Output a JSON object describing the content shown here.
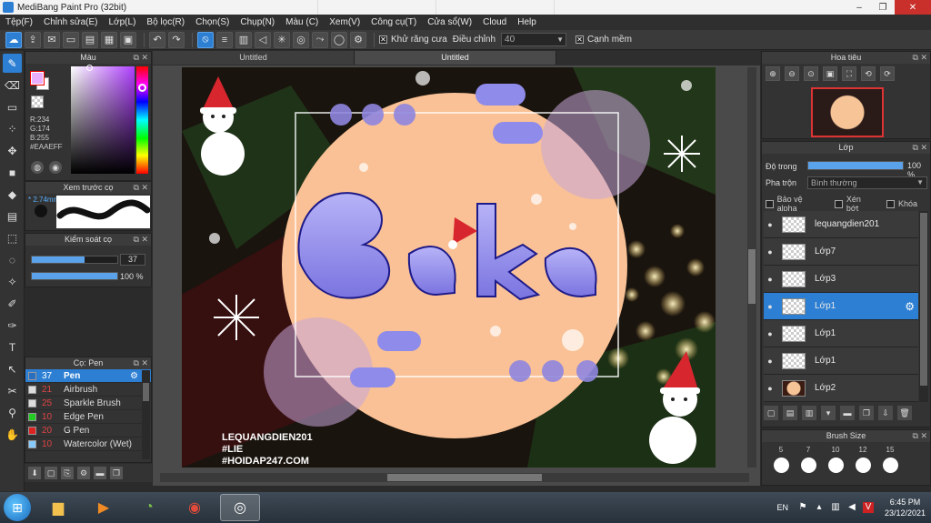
{
  "window": {
    "title": "MediBang Paint Pro (32bit)",
    "controls": [
      "–",
      "❐",
      "✕"
    ]
  },
  "menu": [
    "Tệp(F)",
    "Chỉnh sửa(E)",
    "Lớp(L)",
    "Bộ lọc(R)",
    "Chọn(S)",
    "Chụp(N)",
    "Màu (C)",
    "Xem(V)",
    "Công cụ(T)",
    "Cửa sổ(W)",
    "Cloud",
    "Help"
  ],
  "toolbar": {
    "antialias_label": "Khử răng cưa",
    "correction_label": "Điều chỉnh",
    "correction_value": "40",
    "snap_label": "Cạnh mềm"
  },
  "color_panel": {
    "title": "Màu",
    "r": "R:234",
    "g": "G:174",
    "b": "B:255",
    "hex": "#EAAEFF",
    "fg_color": "#EAAEFF",
    "bg_color": "#FFFFFF"
  },
  "brush_preview": {
    "title": "Xem trước cọ",
    "size": "* 2.74mm"
  },
  "brush_control": {
    "title": "Kiểm soát cọ",
    "size_value": "37",
    "size_fraction": 0.62,
    "opacity_value": "100 %",
    "opacity_fraction": 1.0
  },
  "brushes": {
    "title": "Cọ: Pen",
    "items": [
      {
        "size": "37",
        "name": "Pen",
        "color": "#2a6fbf",
        "selected": true
      },
      {
        "size": "21",
        "name": "Airbrush",
        "color": "#dddddd"
      },
      {
        "size": "25",
        "name": "Sparkle Brush",
        "color": "#dddddd"
      },
      {
        "size": "10",
        "name": "Edge Pen",
        "color": "#22cc22"
      },
      {
        "size": "20",
        "name": "G Pen",
        "color": "#dd2222"
      },
      {
        "size": "10",
        "name": "Watercolor (Wet)",
        "color": "#88ccff"
      }
    ]
  },
  "canvas": {
    "tabs": [
      "Untitled",
      "Untitled"
    ],
    "art_title": "Baka",
    "watermark_lines": [
      "LEQUANGDIEN201",
      "#LIE",
      "#HOIDAP247.COM"
    ]
  },
  "navigator": {
    "title": "Hoa tiêu"
  },
  "layers": {
    "title": "Lớp",
    "opacity_label": "Độ trong",
    "opacity_value": "100 %",
    "blend_label": "Pha trộn",
    "blend_value": "Bình thường",
    "protect_alpha": "Bảo vệ alpha",
    "clip": "Xén bớt",
    "lock": "Khóa",
    "items": [
      {
        "name": "lequangdien201"
      },
      {
        "name": "Lớp7"
      },
      {
        "name": "Lớp3"
      },
      {
        "name": "Lớp1",
        "selected": true
      },
      {
        "name": "Lớp1"
      },
      {
        "name": "Lớp1"
      },
      {
        "name": "Lớp2"
      }
    ]
  },
  "brush_size": {
    "title": "Brush Size",
    "sizes": [
      "5",
      "7",
      "10",
      "12",
      "15"
    ]
  },
  "taskbar": {
    "lang": "EN",
    "time": "6:45 PM",
    "date": "23/12/2021"
  },
  "colors": {
    "accent": "#2D7FD3",
    "peach": "#F9C195",
    "baka_purple": "#8F8BEA",
    "hat_red": "#D8262E"
  }
}
